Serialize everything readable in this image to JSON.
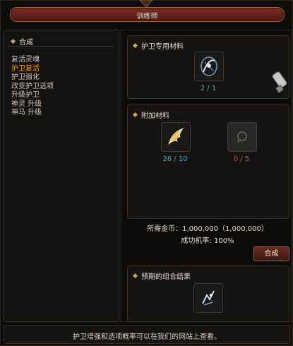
{
  "window": {
    "title": "训练师"
  },
  "left_panel": {
    "title": "合成",
    "items": [
      {
        "label": "复活灵魂",
        "active": false
      },
      {
        "label": "护卫复活",
        "active": true
      },
      {
        "label": "护卫强化",
        "active": false
      },
      {
        "label": "改变护卫选项",
        "active": false
      },
      {
        "label": "升级护卫",
        "active": false
      },
      {
        "label": "神灵 升级",
        "active": false
      },
      {
        "label": "神马 升级",
        "active": false
      }
    ]
  },
  "guard_materials": {
    "title": "护卫专用材料",
    "item_icon": "guard-material-icon",
    "count": "2 / 1"
  },
  "extra_materials": {
    "title": "附加材料",
    "slots": [
      {
        "icon": "wing-feather-icon",
        "count": "26 / 10",
        "count_color": "#4aa6d8"
      },
      {
        "icon": "empty-slot-icon",
        "count": "0 / 5",
        "count_color": "#d9483c"
      }
    ]
  },
  "cost": {
    "gold_text": "所需金币：1,000,000（1,000,000）",
    "success_rate_text": "成功机率: 100%"
  },
  "combine_button": "合成",
  "expected_result": {
    "title": "预期的组合结果",
    "item_icon": "guard-result-icon"
  },
  "footer_text": "护卫增强和选项概率可以在我们的网站上查看。"
}
